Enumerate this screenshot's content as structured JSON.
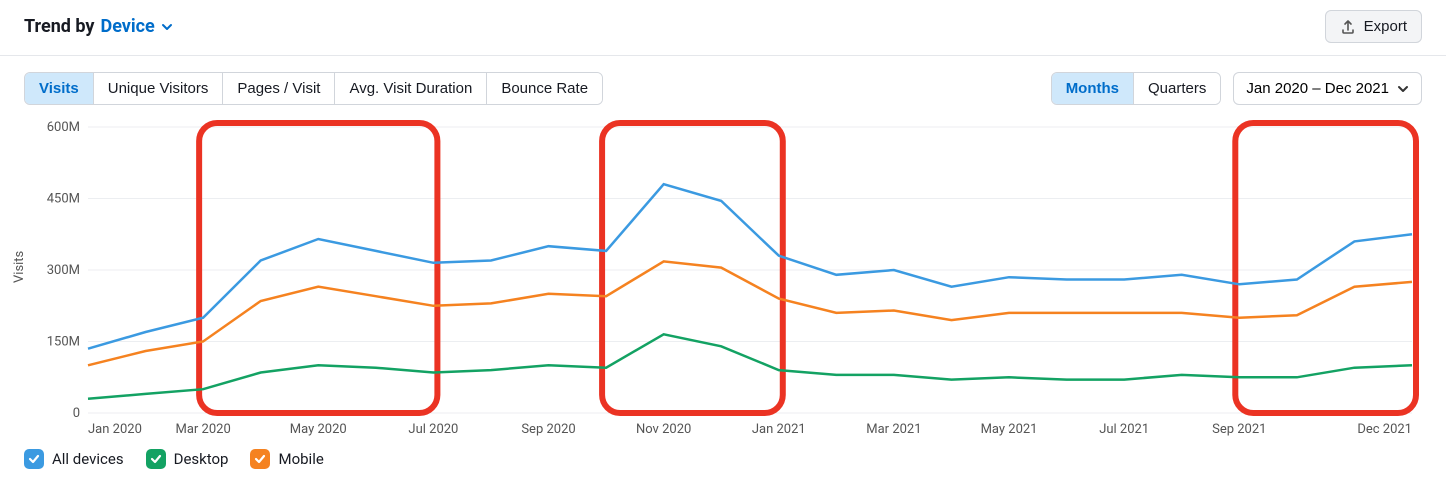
{
  "header": {
    "title_prefix": "Trend by",
    "title_link": "Device",
    "export_label": "Export"
  },
  "metric_tabs": [
    {
      "label": "Visits",
      "active": true
    },
    {
      "label": "Unique Visitors",
      "active": false
    },
    {
      "label": "Pages / Visit",
      "active": false
    },
    {
      "label": "Avg. Visit Duration",
      "active": false
    },
    {
      "label": "Bounce Rate",
      "active": false
    }
  ],
  "granularity_tabs": [
    {
      "label": "Months",
      "active": true
    },
    {
      "label": "Quarters",
      "active": false
    }
  ],
  "date_range": "Jan 2020 – Dec 2021",
  "y_axis_label": "Visits",
  "y_ticks": [
    "0",
    "150M",
    "300M",
    "450M",
    "600M"
  ],
  "x_ticks": [
    "Jan 2020",
    "Mar 2020",
    "May 2020",
    "Jul 2020",
    "Sep 2020",
    "Nov 2020",
    "Jan 2021",
    "Mar 2021",
    "May 2021",
    "Jul 2021",
    "Sep 2021",
    "Dec 2021"
  ],
  "legend": [
    {
      "label": "All devices",
      "color": "#3b9ae1"
    },
    {
      "label": "Desktop",
      "color": "#13a263"
    },
    {
      "label": "Mobile",
      "color": "#f58220"
    }
  ],
  "chart_data": {
    "type": "line",
    "title": "Trend by Device — Visits",
    "xlabel": "",
    "ylabel": "Visits",
    "ylim": [
      0,
      600
    ],
    "y_unit": "M",
    "categories": [
      "Jan 2020",
      "Feb 2020",
      "Mar 2020",
      "Apr 2020",
      "May 2020",
      "Jun 2020",
      "Jul 2020",
      "Aug 2020",
      "Sep 2020",
      "Oct 2020",
      "Nov 2020",
      "Dec 2020",
      "Jan 2021",
      "Feb 2021",
      "Mar 2021",
      "Apr 2021",
      "May 2021",
      "Jun 2021",
      "Jul 2021",
      "Aug 2021",
      "Sep 2021",
      "Oct 2021",
      "Nov 2021",
      "Dec 2021"
    ],
    "series": [
      {
        "name": "All devices",
        "color": "#3b9ae1",
        "values": [
          135,
          170,
          200,
          320,
          365,
          340,
          315,
          320,
          350,
          340,
          480,
          445,
          330,
          290,
          300,
          265,
          285,
          280,
          280,
          290,
          270,
          280,
          360,
          375
        ]
      },
      {
        "name": "Desktop",
        "color": "#13a263",
        "values": [
          30,
          40,
          50,
          85,
          100,
          95,
          85,
          90,
          100,
          95,
          165,
          140,
          90,
          80,
          80,
          70,
          75,
          70,
          70,
          80,
          75,
          75,
          95,
          100
        ]
      },
      {
        "name": "Mobile",
        "color": "#f58220",
        "values": [
          100,
          130,
          150,
          235,
          265,
          245,
          225,
          230,
          250,
          245,
          318,
          305,
          240,
          210,
          215,
          195,
          210,
          210,
          210,
          210,
          200,
          205,
          265,
          275
        ]
      }
    ],
    "highlights": [
      {
        "x_start": 2,
        "x_end": 6
      },
      {
        "x_start": 9,
        "x_end": 12
      },
      {
        "x_start": 20,
        "x_end": 23
      }
    ]
  }
}
